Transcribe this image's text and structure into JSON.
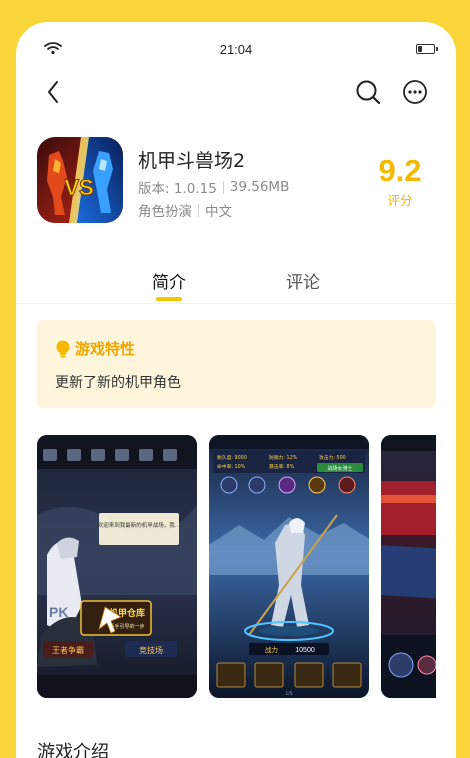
{
  "status_bar": {
    "time": "21:04",
    "battery_level": 0.25
  },
  "nav": {
    "back_icon": "chevron-left-icon",
    "search_icon": "search-icon",
    "more_icon": "more-horizontal-icon"
  },
  "app": {
    "name": "机甲斗兽场2",
    "version": "版本: 1.0.15",
    "size": "39.56MB",
    "category": "角色扮演",
    "language": "中文",
    "score": "9.2",
    "score_label": "评分"
  },
  "tabs": [
    {
      "label": "简介",
      "active": true
    },
    {
      "label": "评论",
      "active": false
    }
  ],
  "feature": {
    "icon": "lightbulb-icon",
    "title": "游戏特性",
    "text": "更新了新的机甲角色"
  },
  "screenshots": {
    "shot1": {
      "dialog": "欢迎来到我最新的机甲战场，我们先来看看你的仓库里有些什么吧",
      "warehouse": "机甲仓库",
      "hint": "新手引导的一步",
      "pk": "PK",
      "king": "王者争霸",
      "arena": "竞技场",
      "menu": [
        "签到",
        "仓库",
        "任务",
        "设置",
        "排行"
      ]
    },
    "shot2": {
      "stat1": "耐久度: 9000",
      "stat2": "防御力: 12%",
      "stat3": "攻击力: 500",
      "stat4": "命中率: 10%",
      "stat5": "暴击率: 8%",
      "stat6": "暴伤: 0%",
      "tag": "战场女骑士",
      "power_label": "战力",
      "power_value": "10500",
      "page": "1/5"
    },
    "shot3": {}
  },
  "section": {
    "title": "游戏介绍"
  },
  "colors": {
    "background": "#f9d53a",
    "accent": "#f5b800",
    "feature_bg": "#fdf6dd"
  }
}
